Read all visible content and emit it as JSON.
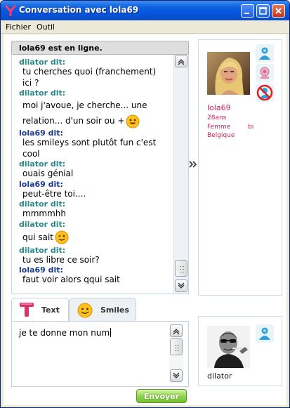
{
  "window": {
    "title": "Conversation avec lola69"
  },
  "menu": {
    "file": "Fichier",
    "tools": "Outil"
  },
  "status": {
    "text": "lola69 est en ligne."
  },
  "chat": {
    "messages": [
      {
        "sender": "dilator dit:",
        "text": "tu cherches quoi (franchement) ici ?"
      },
      {
        "sender": "dilator dit:",
        "text": "moi j'avoue, je cherche... une relation... d'un soir ou +",
        "smiley": "grin"
      },
      {
        "sender": "lola69 dit:",
        "text": "les smileys sont plutôt fun c'est cool"
      },
      {
        "sender": "dilator dit:",
        "text": "ouais génial"
      },
      {
        "sender": "lola69 dit:",
        "text": "peut-être toi...."
      },
      {
        "sender": "dilator dit:",
        "text": "mmmmhh"
      },
      {
        "sender": "dilator dit:",
        "text": "qui sait",
        "smiley": "wink"
      },
      {
        "sender": "dilator dit:",
        "text": "tu es libre ce soir?"
      },
      {
        "sender": "lola69 dit:",
        "text": "faut voir alors qqui sait"
      }
    ]
  },
  "profile": {
    "name": "lola69",
    "age": "28ans",
    "gender": "Femme",
    "orientation": "bi",
    "country": "Belgique",
    "icons": [
      "user-icon",
      "webcam-icon",
      "block-icon"
    ]
  },
  "compose": {
    "tabs": {
      "text": "Text",
      "smileys": "Smiles"
    },
    "input_value": "je te donne mon num",
    "send_label": "Envoyer"
  },
  "me": {
    "name": "dilator"
  },
  "colors": {
    "title_bar": "#0553d8",
    "sender_self": "#2a8a8a",
    "sender_other": "#1a3a8c",
    "profile_text": "#cc2255",
    "send_button": "#8fd14a"
  }
}
